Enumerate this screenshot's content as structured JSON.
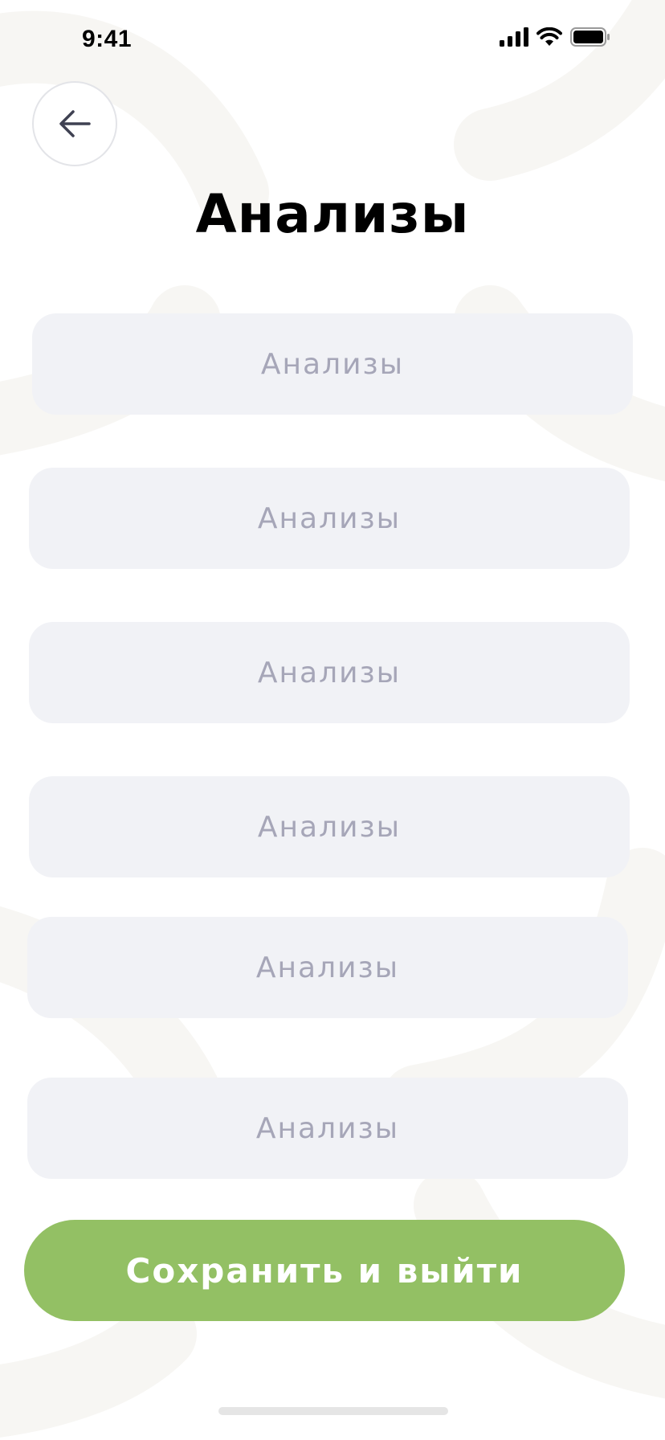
{
  "status_bar": {
    "time": "9:41",
    "icons": [
      "cellular-signal-icon",
      "wifi-icon",
      "battery-icon"
    ]
  },
  "header": {
    "back_icon": "arrow-left-icon",
    "title": "Анализы"
  },
  "fields": [
    {
      "placeholder": "Анализы"
    },
    {
      "placeholder": "Анализы"
    },
    {
      "placeholder": "Анализы"
    },
    {
      "placeholder": "Анализы"
    },
    {
      "placeholder": "Анализы"
    },
    {
      "placeholder": "Анализы"
    }
  ],
  "actions": {
    "save_label": "Сохранить и выйти"
  },
  "colors": {
    "accent": "#93c064",
    "field_background": "#f1f2f6",
    "placeholder_text": "#a6a6b8",
    "title_text": "#000000",
    "background_decor": "#f7f6f3"
  }
}
